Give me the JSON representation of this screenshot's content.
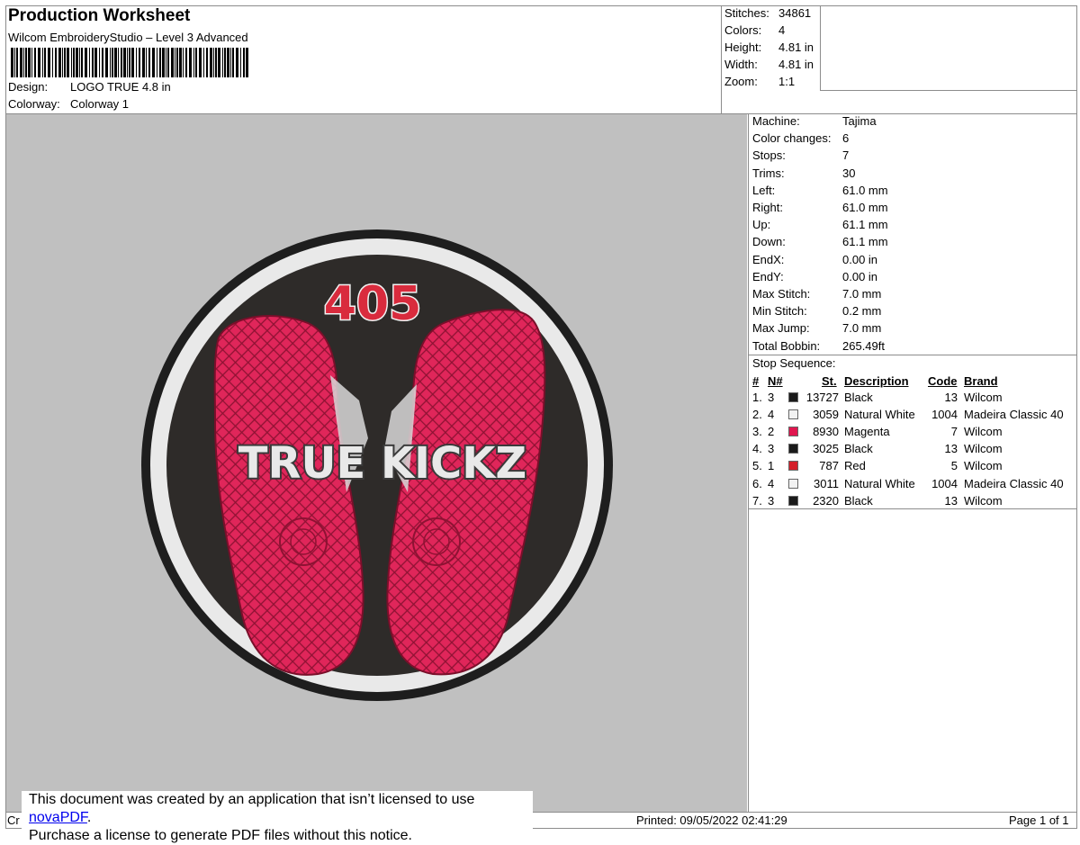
{
  "header": {
    "title": "Production Worksheet",
    "subtitle": "Wilcom EmbroideryStudio – Level 3 Advanced",
    "design_label": "Design:",
    "design_value": "LOGO TRUE 4.8 in",
    "colorway_label": "Colorway:",
    "colorway_value": "Colorway 1"
  },
  "summary": {
    "stitches_label": "Stitches:",
    "stitches_value": "34861",
    "colors_label": "Colors:",
    "colors_value": "4",
    "height_label": "Height:",
    "height_value": "4.81 in",
    "width_label": "Width:",
    "width_value": "4.81 in",
    "zoom_label": "Zoom:",
    "zoom_value": "1:1"
  },
  "design": {
    "top_text": "405",
    "main_text": "TRUE KICKZ",
    "colors": {
      "ring": "#e9e9e9",
      "outer": "#1e1e1e",
      "background": "#2e2b29",
      "sole": "#e0265a",
      "text_red": "#d92b3d"
    }
  },
  "machine": [
    {
      "label": "Machine:",
      "value": "Tajima"
    },
    {
      "label": "Color changes:",
      "value": "6"
    },
    {
      "label": "Stops:",
      "value": "7"
    },
    {
      "label": "Trims:",
      "value": "30"
    },
    {
      "label": "Left:",
      "value": "61.0 mm"
    },
    {
      "label": "Right:",
      "value": "61.0 mm"
    },
    {
      "label": "Up:",
      "value": "61.1 mm"
    },
    {
      "label": "Down:",
      "value": "61.1 mm"
    },
    {
      "label": "EndX:",
      "value": "0.00 in"
    },
    {
      "label": "EndY:",
      "value": "0.00 in"
    },
    {
      "label": "Max Stitch:",
      "value": "7.0 mm"
    },
    {
      "label": "Min Stitch:",
      "value": "0.2 mm"
    },
    {
      "label": "Max Jump:",
      "value": "7.0 mm"
    },
    {
      "label": "Total Bobbin:",
      "value": "265.49ft"
    }
  ],
  "stop_sequence": {
    "label": "Stop Sequence:",
    "headers": {
      "num": "#",
      "n": "N#",
      "st": "St.",
      "description": "Description",
      "code": "Code",
      "brand": "Brand"
    },
    "rows": [
      {
        "idx": "1.",
        "n": "3",
        "st": "13727",
        "desc": "Black",
        "code": "13",
        "brand": "Wilcom",
        "color": "#1a1a1a"
      },
      {
        "idx": "2.",
        "n": "4",
        "st": "3059",
        "desc": "Natural White",
        "code": "1004",
        "brand": "Madeira Classic 40",
        "color": "#f2f2f2"
      },
      {
        "idx": "3.",
        "n": "2",
        "st": "8930",
        "desc": "Magenta",
        "code": "7",
        "brand": "Wilcom",
        "color": "#e0164f"
      },
      {
        "idx": "4.",
        "n": "3",
        "st": "3025",
        "desc": "Black",
        "code": "13",
        "brand": "Wilcom",
        "color": "#1a1a1a"
      },
      {
        "idx": "5.",
        "n": "1",
        "st": "787",
        "desc": "Red",
        "code": "5",
        "brand": "Wilcom",
        "color": "#d4202a"
      },
      {
        "idx": "6.",
        "n": "4",
        "st": "3011",
        "desc": "Natural White",
        "code": "1004",
        "brand": "Madeira Classic 40",
        "color": "#f2f2f2"
      },
      {
        "idx": "7.",
        "n": "3",
        "st": "2320",
        "desc": "Black",
        "code": "13",
        "brand": "Wilcom",
        "color": "#1a1a1a"
      }
    ]
  },
  "footer": {
    "notice_line1": "This document was created by an application that isn’t licensed to use ",
    "notice_link": "novaPDF",
    "notice_line1_end": ".",
    "notice_line2": "Purchase a license to generate PDF files without this notice.",
    "cr_text": "Cr",
    "printed": "Printed: 09/05/2022 02:41:29",
    "page": "Page 1 of 1"
  }
}
